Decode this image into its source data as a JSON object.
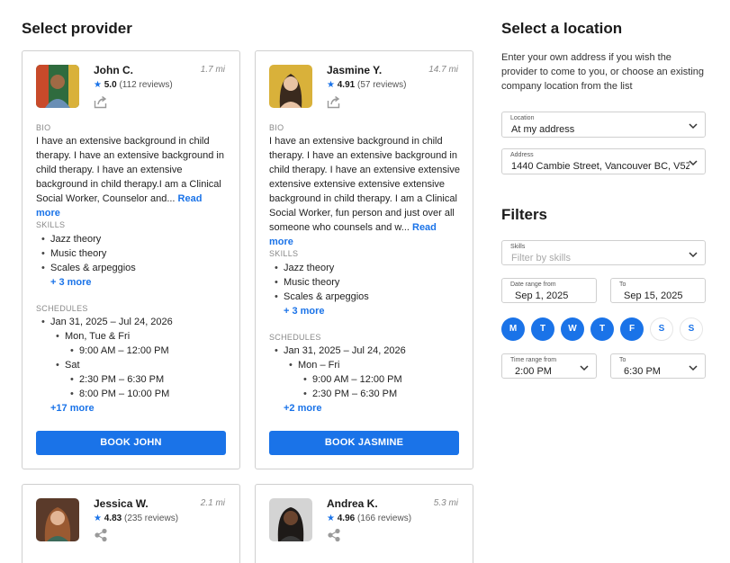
{
  "headings": {
    "select_provider": "Select provider",
    "select_location": "Select a location",
    "filters": "Filters"
  },
  "location_intro": "Enter your own address if you wish the provider to come to you, or choose an existing company location from the list",
  "labels": {
    "bio": "BIO",
    "skills": "SKILLS",
    "schedules": "SCHEDULES"
  },
  "providers": [
    {
      "name": "John C.",
      "distance": "1.7 mi",
      "rating": "5.0",
      "reviews": "(112 reviews)",
      "bio": "I have an extensive background in child therapy. I have an extensive background in child therapy. I have an extensive background in child therapy.I am a Clinical Social Worker, Counselor and...",
      "read_more": "Read more",
      "skills": [
        "Jazz theory",
        "Music theory",
        "Scales & arpeggios"
      ],
      "skills_more": "+ 3 more",
      "schedule_range": "Jan 31, 2025 – Jul 24, 2026",
      "schedule_days_1": "Mon, Tue & Fri",
      "schedule_times_1": [
        "9:00 AM – 12:00 PM"
      ],
      "schedule_days_2": "Sat",
      "schedule_times_2": [
        "2:30 PM – 6:30 PM",
        "8:00 PM – 10:00 PM"
      ],
      "schedule_more": "+17 more",
      "book_label": "BOOK JOHN",
      "avatar_bg": "#3b7a4a"
    },
    {
      "name": "Jasmine Y.",
      "distance": "14.7 mi",
      "rating": "4.91",
      "reviews": "(57 reviews)",
      "bio": "I have an extensive background in child therapy. I have an extensive background in child therapy. I have an extensive extensive extensive extensive extensive extensive background in child therapy. I am a Clinical Social Worker, fun person and just over all someone who counsels and w...",
      "read_more": "Read more",
      "skills": [
        "Jazz theory",
        "Music theory",
        "Scales & arpeggios"
      ],
      "skills_more": "+ 3 more",
      "schedule_range": "Jan 31, 2025 – Jul 24, 2026",
      "schedule_days_1": "Mon – Fri",
      "schedule_times_1": [
        "9:00 AM – 12:00 PM",
        "2:30 PM – 6:30 PM"
      ],
      "schedule_more": "+2 more",
      "book_label": "BOOK JASMINE",
      "avatar_bg": "#d9b13a"
    },
    {
      "name": "Jessica W.",
      "distance": "2.1 mi",
      "rating": "4.83",
      "reviews": "(235 reviews)",
      "avatar_bg": "#8a5a3c"
    },
    {
      "name": "Andrea K.",
      "distance": "5.3 mi",
      "rating": "4.96",
      "reviews": "(166 reviews)",
      "avatar_bg": "#c9c9c9"
    }
  ],
  "location": {
    "location_label": "Location",
    "location_value": "At my address",
    "address_label": "Address",
    "address_value": "1440 Cambie Street, Vancouver BC, V5Z..."
  },
  "filters": {
    "skills_label": "Skills",
    "skills_placeholder": "Filter by skills",
    "date_from_label": "Date range from",
    "date_from_value": "Sep 1, 2025",
    "date_to_label": "To",
    "date_to_value": "Sep 15, 2025",
    "days": [
      {
        "letter": "M",
        "selected": true
      },
      {
        "letter": "T",
        "selected": true
      },
      {
        "letter": "W",
        "selected": true
      },
      {
        "letter": "T",
        "selected": true
      },
      {
        "letter": "F",
        "selected": true
      },
      {
        "letter": "S",
        "selected": false
      },
      {
        "letter": "S",
        "selected": false
      }
    ],
    "time_from_label": "Time range from",
    "time_from_value": "2:00 PM",
    "time_to_label": "To",
    "time_to_value": "6:30 PM"
  },
  "colors": {
    "accent": "#1a73e8",
    "border": "#cfcfcf"
  }
}
